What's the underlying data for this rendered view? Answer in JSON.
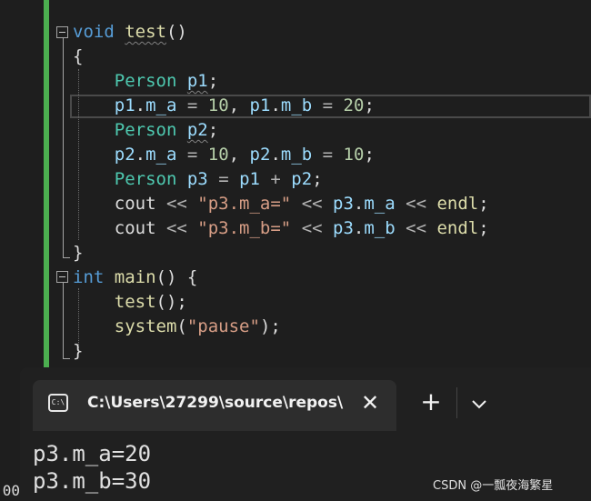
{
  "editor": {
    "lines": [
      [
        {
          "c": "kw",
          "t": "void"
        },
        {
          "c": "plain",
          "t": " "
        },
        {
          "c": "fn",
          "t": "test",
          "sq": true
        },
        {
          "c": "plain",
          "t": "()"
        }
      ],
      [
        {
          "c": "plain",
          "t": "{"
        }
      ],
      [
        {
          "c": "plain",
          "t": "    "
        },
        {
          "c": "ty",
          "t": "Person"
        },
        {
          "c": "plain",
          "t": " "
        },
        {
          "c": "var",
          "t": "p1",
          "sq": true
        },
        {
          "c": "plain",
          "t": ";"
        }
      ],
      [
        {
          "c": "plain",
          "t": "    "
        },
        {
          "c": "var",
          "t": "p1"
        },
        {
          "c": "plain",
          "t": "."
        },
        {
          "c": "var",
          "t": "m_a"
        },
        {
          "c": "op",
          "t": " = "
        },
        {
          "c": "num",
          "t": "10"
        },
        {
          "c": "plain",
          "t": ", "
        },
        {
          "c": "var",
          "t": "p1"
        },
        {
          "c": "plain",
          "t": "."
        },
        {
          "c": "var",
          "t": "m_b"
        },
        {
          "c": "op",
          "t": " = "
        },
        {
          "c": "num",
          "t": "20"
        },
        {
          "c": "plain",
          "t": ";"
        }
      ],
      [
        {
          "c": "plain",
          "t": "    "
        },
        {
          "c": "ty",
          "t": "Person"
        },
        {
          "c": "plain",
          "t": " "
        },
        {
          "c": "var",
          "t": "p2",
          "sq": true
        },
        {
          "c": "plain",
          "t": ";"
        }
      ],
      [
        {
          "c": "plain",
          "t": "    "
        },
        {
          "c": "var",
          "t": "p2"
        },
        {
          "c": "plain",
          "t": "."
        },
        {
          "c": "var",
          "t": "m_a"
        },
        {
          "c": "op",
          "t": " = "
        },
        {
          "c": "num",
          "t": "10"
        },
        {
          "c": "plain",
          "t": ", "
        },
        {
          "c": "var",
          "t": "p2"
        },
        {
          "c": "plain",
          "t": "."
        },
        {
          "c": "var",
          "t": "m_b"
        },
        {
          "c": "op",
          "t": " = "
        },
        {
          "c": "num",
          "t": "10"
        },
        {
          "c": "plain",
          "t": ";"
        }
      ],
      [
        {
          "c": "plain",
          "t": "    "
        },
        {
          "c": "ty",
          "t": "Person"
        },
        {
          "c": "plain",
          "t": " "
        },
        {
          "c": "var",
          "t": "p3"
        },
        {
          "c": "op",
          "t": " = "
        },
        {
          "c": "var",
          "t": "p1"
        },
        {
          "c": "op",
          "t": " + "
        },
        {
          "c": "var",
          "t": "p2"
        },
        {
          "c": "plain",
          "t": ";"
        }
      ],
      [
        {
          "c": "plain",
          "t": "    "
        },
        {
          "c": "plain",
          "t": "cout"
        },
        {
          "c": "op",
          "t": " << "
        },
        {
          "c": "str",
          "t": "\"p3.m_a=\""
        },
        {
          "c": "op",
          "t": " << "
        },
        {
          "c": "var",
          "t": "p3"
        },
        {
          "c": "plain",
          "t": "."
        },
        {
          "c": "var",
          "t": "m_a"
        },
        {
          "c": "op",
          "t": " << "
        },
        {
          "c": "fn",
          "t": "endl"
        },
        {
          "c": "plain",
          "t": ";"
        }
      ],
      [
        {
          "c": "plain",
          "t": "    "
        },
        {
          "c": "plain",
          "t": "cout"
        },
        {
          "c": "op",
          "t": " << "
        },
        {
          "c": "str",
          "t": "\"p3.m_b=\""
        },
        {
          "c": "op",
          "t": " << "
        },
        {
          "c": "var",
          "t": "p3"
        },
        {
          "c": "plain",
          "t": "."
        },
        {
          "c": "var",
          "t": "m_b"
        },
        {
          "c": "op",
          "t": " << "
        },
        {
          "c": "fn",
          "t": "endl"
        },
        {
          "c": "plain",
          "t": ";"
        }
      ],
      [
        {
          "c": "plain",
          "t": "}"
        }
      ],
      [
        {
          "c": "kw",
          "t": "int"
        },
        {
          "c": "plain",
          "t": " "
        },
        {
          "c": "fn",
          "t": "main"
        },
        {
          "c": "plain",
          "t": "() {"
        }
      ],
      [
        {
          "c": "plain",
          "t": "    "
        },
        {
          "c": "fn",
          "t": "test"
        },
        {
          "c": "plain",
          "t": "();"
        }
      ],
      [
        {
          "c": "plain",
          "t": "    "
        },
        {
          "c": "fn",
          "t": "system"
        },
        {
          "c": "plain",
          "t": "("
        },
        {
          "c": "str",
          "t": "\"pause\""
        },
        {
          "c": "plain",
          "t": ");"
        }
      ],
      [
        {
          "c": "plain",
          "t": "}"
        }
      ]
    ]
  },
  "terminal": {
    "tab_title": "C:\\Users\\27299\\source\\repos\\",
    "tab_icon_text": "C:\\",
    "close_symbol": "✕",
    "new_tab_symbol": "+",
    "output": [
      "p3.m_a=20",
      "p3.m_b=30"
    ]
  },
  "left_stub": "00",
  "watermark": "CSDN @一瓢夜海繁星",
  "colors": {
    "keyword": "#569cd6",
    "type": "#4ec9b0",
    "function": "#dcdcaa",
    "variable": "#9cdcfe",
    "string": "#d69d85",
    "number": "#b5cea8",
    "change_bar": "#4caf50",
    "terminal_bg": "#202020",
    "tab_bg": "#2d2d2d"
  },
  "icons": {
    "fold": "collapse-box-icon",
    "terminal": "console-app-icon",
    "close": "close-icon",
    "add": "plus-icon",
    "menu": "chevron-down-icon"
  }
}
